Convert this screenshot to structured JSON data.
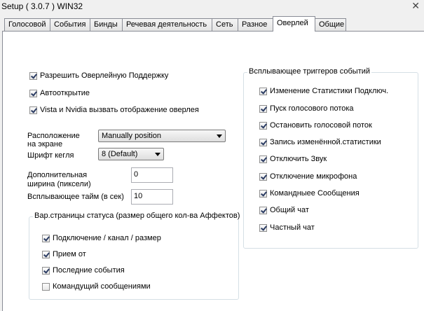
{
  "window": {
    "title": "Setup ( 3.0.7 ) WIN32",
    "close_glyph": "✕"
  },
  "tabs": [
    {
      "label": "Голосовой"
    },
    {
      "label": "События"
    },
    {
      "label": "Бинды"
    },
    {
      "label": "Речевая деятельность"
    },
    {
      "label": "Сеть"
    },
    {
      "label": "Разное"
    },
    {
      "label": "Оверлей",
      "active": true
    },
    {
      "label": "Общие"
    }
  ],
  "overlay": {
    "enable_support": {
      "label": "Разрешить Оверлейную Поддержку",
      "checked": true
    },
    "autostart": {
      "label": "Автооткрытие",
      "checked": true
    },
    "vista_nvidia": {
      "label": "Vista и Nvidia вызвать отображение оверлея",
      "checked": true
    },
    "position_label_1": "Расположение",
    "position_label_2": "на экране",
    "position_value": "Manually position",
    "font_label": "Шрифт кегля",
    "font_value": "8 (Default)",
    "extra_width_label_1": "Дополнительная",
    "extra_width_label_2": "ширина (пиксели)",
    "extra_width_value": "0",
    "popup_time_label": "Всплывающее тайм (в сек)",
    "popup_time_value": "10"
  },
  "status_group": {
    "title": "Вар.страницы статуса (размер общего кол-ва Аффектов)",
    "items": [
      {
        "label": "Подключение / канал / размер",
        "checked": true
      },
      {
        "label": "Прием от",
        "checked": true
      },
      {
        "label": "Последние события",
        "checked": true
      },
      {
        "label": "Командущий сообщениями",
        "checked": false
      }
    ]
  },
  "triggers_group": {
    "title": "Всплывающее триггеров событий",
    "items": [
      {
        "label": "Изменение Статистики Подключ.",
        "checked": true
      },
      {
        "label": "Пуск голосового потока",
        "checked": true
      },
      {
        "label": "Остановить голосовой поток",
        "checked": true
      },
      {
        "label": "Запись изменённой.статистики",
        "checked": true
      },
      {
        "label": "Отключить Звук",
        "checked": true
      },
      {
        "label": "Отключение микрофона",
        "checked": true
      },
      {
        "label": "Командныее Сообщения",
        "checked": true
      },
      {
        "label": "Общий чат",
        "checked": true
      },
      {
        "label": "Частный чат",
        "checked": true
      }
    ]
  }
}
